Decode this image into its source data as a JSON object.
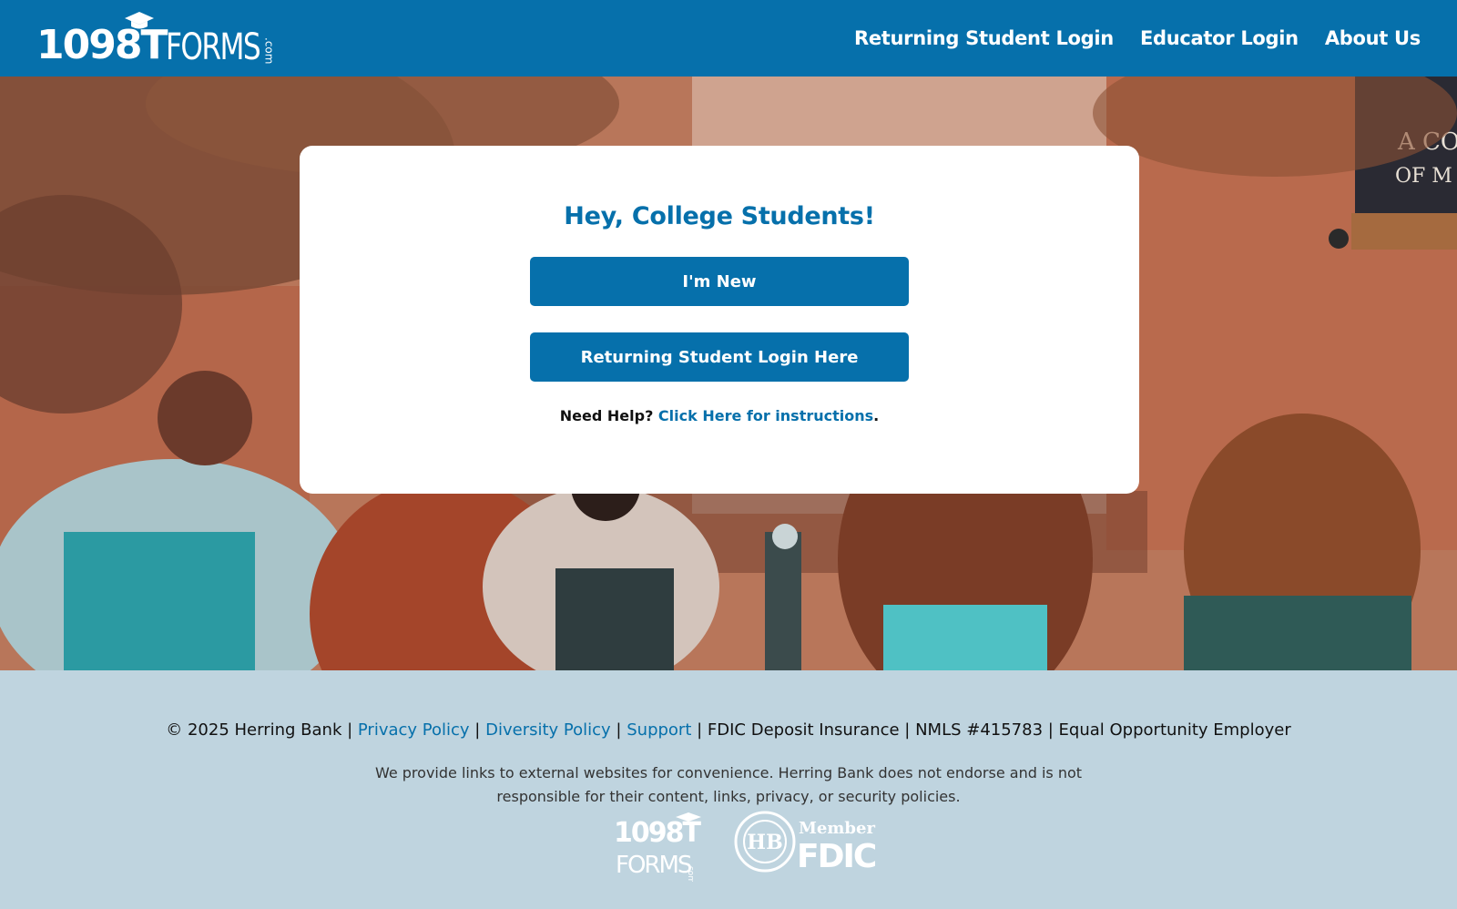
{
  "header": {
    "logo": {
      "number": "1098T",
      "word": "FORMS",
      "suffix": ".com"
    },
    "nav": [
      {
        "label": "Returning Student Login"
      },
      {
        "label": "Educator Login"
      },
      {
        "label": "About Us"
      }
    ]
  },
  "hero": {
    "banner_text": [
      "A CO",
      "OF M"
    ]
  },
  "card": {
    "title": "Hey, College Students!",
    "new_button": "I'm New",
    "returning_button": "Returning Student Login Here",
    "help_prefix": "Need Help?",
    "help_link": "Click Here for instructions",
    "help_suffix": "."
  },
  "footer": {
    "copyright": "© 2025 Herring Bank |",
    "privacy": "Privacy Policy",
    "sep1": "|",
    "diversity": "Diversity Policy",
    "sep2": "|",
    "support": "Support",
    "rest": "| FDIC Deposit Insurance | NMLS #415783 | Equal Opportunity Employer",
    "disclaimer": "We provide links to external websites for convenience. Herring Bank does not endorse and is not responsible for their content, links, privacy, or security policies.",
    "logo_number": "1098T",
    "logo_word": "FORMS",
    "logo_suffix": ".com",
    "member": "Member",
    "fdic": "FDIC"
  },
  "colors": {
    "brand_blue": "#0670ab",
    "footer_bg": "#bfd4df",
    "card_bg": "#ffffff"
  },
  "icons": [
    "graduation-cap-icon",
    "herring-bank-seal-icon"
  ]
}
